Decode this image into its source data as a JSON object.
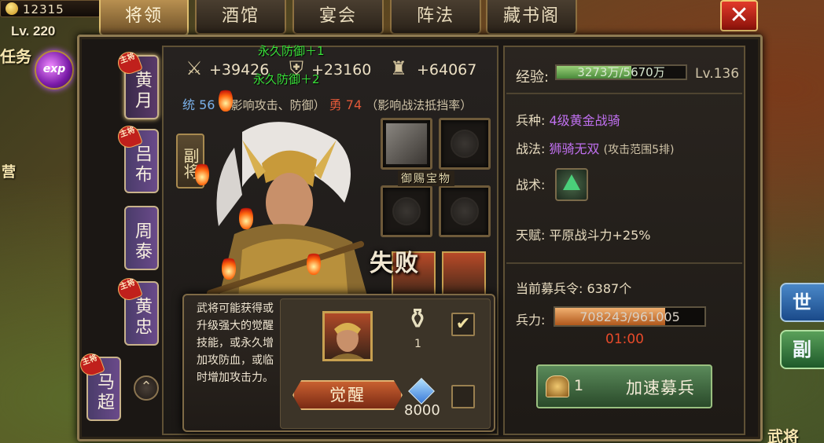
{
  "hud": {
    "gold": "12315",
    "level": "Lv. 220",
    "exp_badge": "exp",
    "task_label": "任务",
    "camp_label": "营"
  },
  "tabs": [
    {
      "label": "将领",
      "active": true
    },
    {
      "label": "酒馆",
      "active": false
    },
    {
      "label": "宴会",
      "active": false
    },
    {
      "label": "阵法",
      "active": false
    },
    {
      "label": "藏书阁",
      "active": false
    }
  ],
  "close_icon": "close-icon",
  "heroes": [
    {
      "name": "黄月",
      "badge": "主将"
    },
    {
      "name": "吕布",
      "badge": "主将"
    },
    {
      "name": "周泰",
      "badge": ""
    },
    {
      "name": "黄忠",
      "badge": "主将"
    },
    {
      "name": "马超",
      "badge": "主将"
    }
  ],
  "stats": {
    "attack": "+39426",
    "defense": "+23160",
    "hp": "+64067",
    "buff1": "永久防御＋1",
    "buff2": "永久防御＋2",
    "tong_label": "统",
    "tong_value": "56",
    "tong_desc": "（影响攻击、防御）",
    "yong_label": "勇",
    "yong_value": "74",
    "yong_desc": "（影响战法抵挡率）"
  },
  "portrait": {
    "side_tag": "副将",
    "fail_text": "失败",
    "treasure_label": "御赐宝物"
  },
  "awaken": {
    "description": "武将可能获得或升级强大的觉醒技能，或永久增加攻防血，或临时增加攻击力。",
    "teapot_count": "1",
    "button_label": "觉醒",
    "diamond_cost": "8000",
    "teapot_checked": true,
    "diamond_checked": false
  },
  "right": {
    "exp_label": "经验:",
    "exp_text": "3273万/5670万",
    "exp_progress": 0.577,
    "level": "Lv.136",
    "troop_type_label": "兵种:",
    "troop_type": "4级黄金战骑",
    "tactic_label": "战法:",
    "tactic_name": "狮骑无双",
    "tactic_range": "(攻击范围5排)",
    "skill_label": "战术:",
    "talent_label": "天赋:",
    "talent": "平原战斗力+25%",
    "recruit_token_label": "当前募兵令:",
    "recruit_token": "6387个",
    "troop_label": "兵力:",
    "troop_text": "708243/961005",
    "troop_progress": 0.737,
    "timer": "01:00",
    "speed_count": "1",
    "speed_label": "加速募兵"
  },
  "outside": {
    "btn_world": "世",
    "btn_deputy": "副",
    "bottom_text": "武将"
  },
  "colors": {
    "buff_green": "#38e038",
    "purple": "#c070f0",
    "timer_red": "#e84a2a",
    "tong_blue": "#7ab0e8",
    "yong_red": "#e05838"
  }
}
